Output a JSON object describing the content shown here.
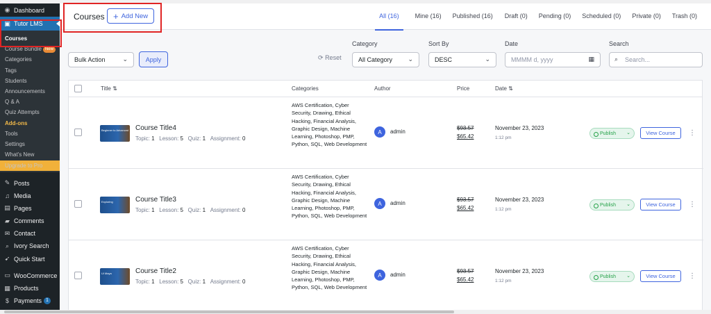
{
  "sidebar": {
    "dashboard": "Dashboard",
    "tutor": "Tutor LMS",
    "submenu": [
      "Courses",
      "Course Bundle",
      "Categories",
      "Tags",
      "Students",
      "Announcements",
      "Q & A",
      "Quiz Attempts",
      "Add-ons",
      "Tools",
      "Settings",
      "What's New"
    ],
    "new_badge": "New",
    "upgrade": "Upgrade to Pro",
    "main_items": [
      "Posts",
      "Media",
      "Pages",
      "Comments",
      "Contact",
      "Ivory Search",
      "Quick Start",
      "WooCommerce",
      "Products",
      "Payments"
    ],
    "payments_count": "1"
  },
  "header": {
    "title": "Courses",
    "add_new": "Add New",
    "tabs": [
      "All (16)",
      "Mine (16)",
      "Published (16)",
      "Draft (0)",
      "Pending (0)",
      "Scheduled (0)",
      "Private (0)",
      "Trash (0)"
    ]
  },
  "filters": {
    "bulk_action": "Bulk Action",
    "apply": "Apply",
    "reset": "Reset",
    "category_label": "Category",
    "category_value": "All Category",
    "sort_label": "Sort By",
    "sort_value": "DESC",
    "date_label": "Date",
    "date_placeholder": "MMMM d, yyyy",
    "search_label": "Search",
    "search_placeholder": "Search..."
  },
  "table": {
    "headers": {
      "title": "Title",
      "categories": "Categories",
      "author": "Author",
      "price": "Price",
      "date": "Date"
    },
    "rows": [
      {
        "title": "Course Title4",
        "topic_label": "Topic:",
        "topic": "1",
        "lesson_label": "Lesson:",
        "lesson": "5",
        "quiz_label": "Quiz:",
        "quiz": "1",
        "assignment_label": "Assignment:",
        "assignment": "0",
        "categories": "AWS Certification, Cyber Security, Drawing, Ethical Hacking, Financial Analysis, Graphic Design, Machine Learning, Photoshop, PMP, Python, SQL, Web Development",
        "avatar": "A",
        "author": "admin",
        "price_old": "$93.57",
        "price_new": "$65.42",
        "date": "November 23, 2023",
        "time": "1:12 pm",
        "status": "Publish",
        "view": "View Course",
        "thumb_text": "Beginner to Advanced"
      },
      {
        "title": "Course Title3",
        "topic_label": "Topic:",
        "topic": "1",
        "lesson_label": "Lesson:",
        "lesson": "5",
        "quiz_label": "Quiz:",
        "quiz": "1",
        "assignment_label": "Assignment:",
        "assignment": "0",
        "categories": "AWS Certification, Cyber Security, Drawing, Ethical Hacking, Financial Analysis, Graphic Design, Machine Learning, Photoshop, PMP, Python, SQL, Web Development",
        "avatar": "A",
        "author": "admin",
        "price_old": "$93.57",
        "price_new": "$65.42",
        "date": "November 23, 2023",
        "time": "1:12 pm",
        "status": "Publish",
        "view": "View Course",
        "thumb_text": "Exploring"
      },
      {
        "title": "Course Title2",
        "topic_label": "Topic:",
        "topic": "1",
        "lesson_label": "Lesson:",
        "lesson": "5",
        "quiz_label": "Quiz:",
        "quiz": "1",
        "assignment_label": "Assignment:",
        "assignment": "0",
        "categories": "AWS Certification, Cyber Security, Drawing, Ethical Hacking, Financial Analysis, Graphic Design, Machine Learning, Photoshop, PMP, Python, SQL, Web Development",
        "avatar": "A",
        "author": "admin",
        "price_old": "$93.57",
        "price_new": "$65.42",
        "date": "November 23, 2023",
        "time": "1:12 pm",
        "status": "Publish",
        "view": "View Course",
        "thumb_text": "Ui Maya"
      }
    ]
  },
  "colors": {
    "accent": "#3e64de",
    "sidebar": "#1d2327",
    "wp_blue": "#2271b1",
    "publish_green": "#24a148",
    "highlight": "#e02424"
  }
}
